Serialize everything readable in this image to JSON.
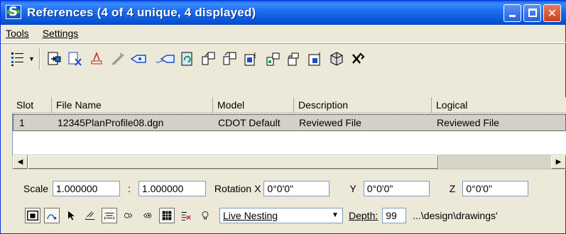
{
  "window": {
    "title": "References (4 of 4 unique, 4 displayed)",
    "controls": [
      "minimize",
      "maximize",
      "close"
    ]
  },
  "menu": {
    "items": [
      {
        "label": "Tools"
      },
      {
        "label": "Settings"
      }
    ]
  },
  "toolbar": {
    "icons": [
      "tree-list-icon",
      "attach-reference-icon",
      "detach-reference-icon",
      "reload-reference-icon",
      "exchange-reference-icon",
      "move-reference-icon",
      "copy-reference-icon",
      "hilite-reference-icon",
      "scale-reference-icon",
      "rotate-reference-icon",
      "mirror-horizontal-icon",
      "mirror-vertical-icon",
      "clip-boundary-icon",
      "clip-mask-icon",
      "clip-delete-icon",
      "merge-into-master-icon",
      "make-copy-icon"
    ]
  },
  "table": {
    "columns": [
      "Slot",
      "File Name",
      "Model",
      "Description",
      "Logical"
    ],
    "rows": [
      {
        "slot": "1",
        "file_name": "12345PlanProfile08.dgn",
        "model": "CDOT Default",
        "description": "Reviewed File",
        "logical": "Reviewed File"
      }
    ]
  },
  "fields": {
    "scale_label": "Scale",
    "scale_master": "1.000000",
    "colon": ":",
    "scale_ref": "1.000000",
    "rotation_label": "Rotation",
    "x_label": "X",
    "x_value": "0°0'0\"",
    "y_label": "Y",
    "y_value": "0°0'0\"",
    "z_label": "Z",
    "z_value": "0°0'0\""
  },
  "bottom": {
    "nesting": "Live Nesting",
    "depth_label": "Depth:",
    "depth_value": "99",
    "path": "...\\design\\drawings'"
  }
}
